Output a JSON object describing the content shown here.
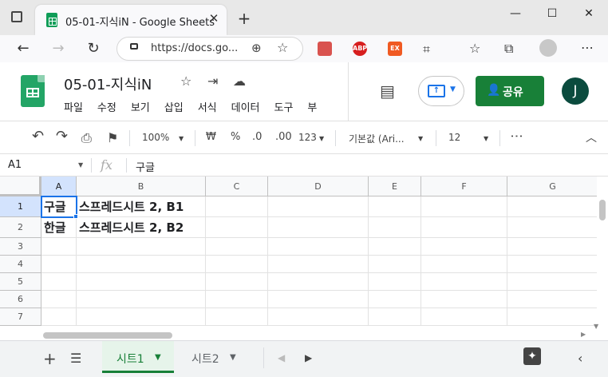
{
  "browser": {
    "tab_title": "05-01-지식iN - Google Sheets",
    "tab_close": "✕",
    "new_tab": "+",
    "url": "https://docs.go...",
    "window_controls": [
      "—",
      "☐",
      "✕"
    ],
    "ext_labels": [
      "ABP",
      "EX"
    ]
  },
  "doc": {
    "title": "05-01-지식iN",
    "menus": [
      "파일",
      "수정",
      "보기",
      "삽입",
      "서식",
      "데이터",
      "도구",
      "부"
    ],
    "share_label": "공유",
    "user_initial": "J"
  },
  "toolbar": {
    "zoom": "100%",
    "currency": "₩",
    "percent": "%",
    "dec_less": ".0",
    "dec_more": ".00",
    "format": "123",
    "font": "기본값 (Ari...",
    "font_size": "12",
    "more": "⋮"
  },
  "formula_bar": {
    "name_box": "A1",
    "fx": "fx",
    "content": "구글"
  },
  "grid": {
    "columns": [
      "A",
      "B",
      "C",
      "D",
      "E",
      "F",
      "G"
    ],
    "rows": [
      "1",
      "2",
      "3",
      "4",
      "5",
      "6",
      "7"
    ],
    "cells": {
      "A1": "구글",
      "B1": "스프레드시트 2, B1",
      "A2": "한글",
      "B2": "스프레드시트 2, B2"
    }
  },
  "sheets": {
    "tabs": [
      "시트1",
      "시트2"
    ],
    "active": "시트1"
  },
  "colors": {
    "accent_green": "#188038",
    "selection_blue": "#1a73e8"
  }
}
